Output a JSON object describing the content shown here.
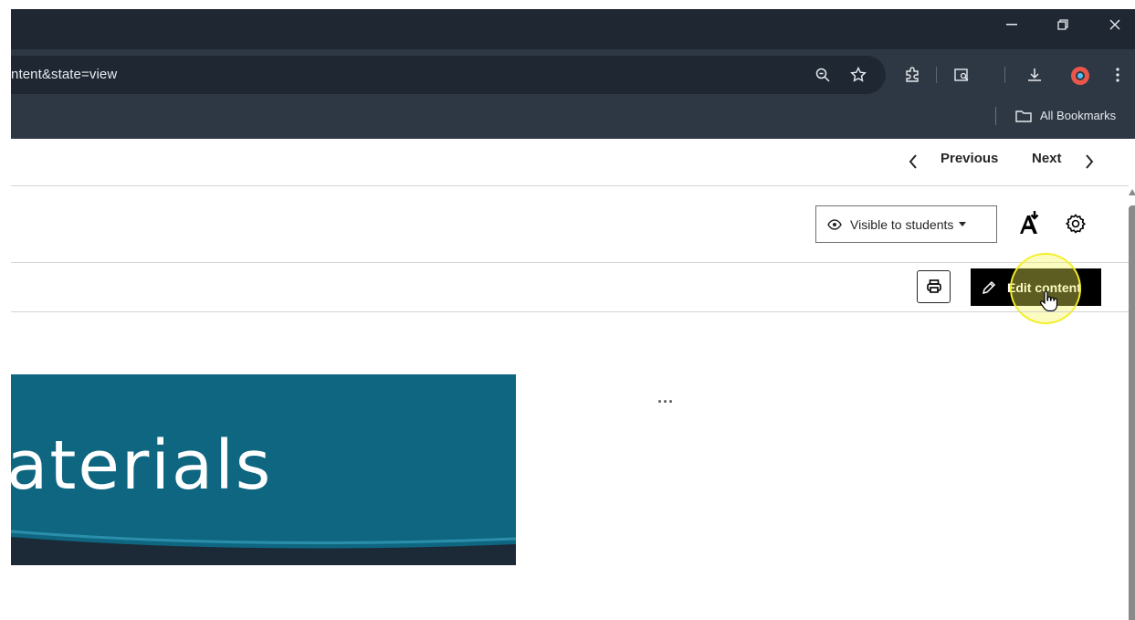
{
  "browser": {
    "url_fragment": "ntent&state=view",
    "bookmarks_label": "All Bookmarks"
  },
  "page_nav": {
    "previous_label": "Previous",
    "next_label": "Next"
  },
  "header_actions": {
    "visibility_label": "Visible to students",
    "edit_label": "Edit content"
  },
  "banner": {
    "text": "aterials"
  },
  "more_label": "..."
}
